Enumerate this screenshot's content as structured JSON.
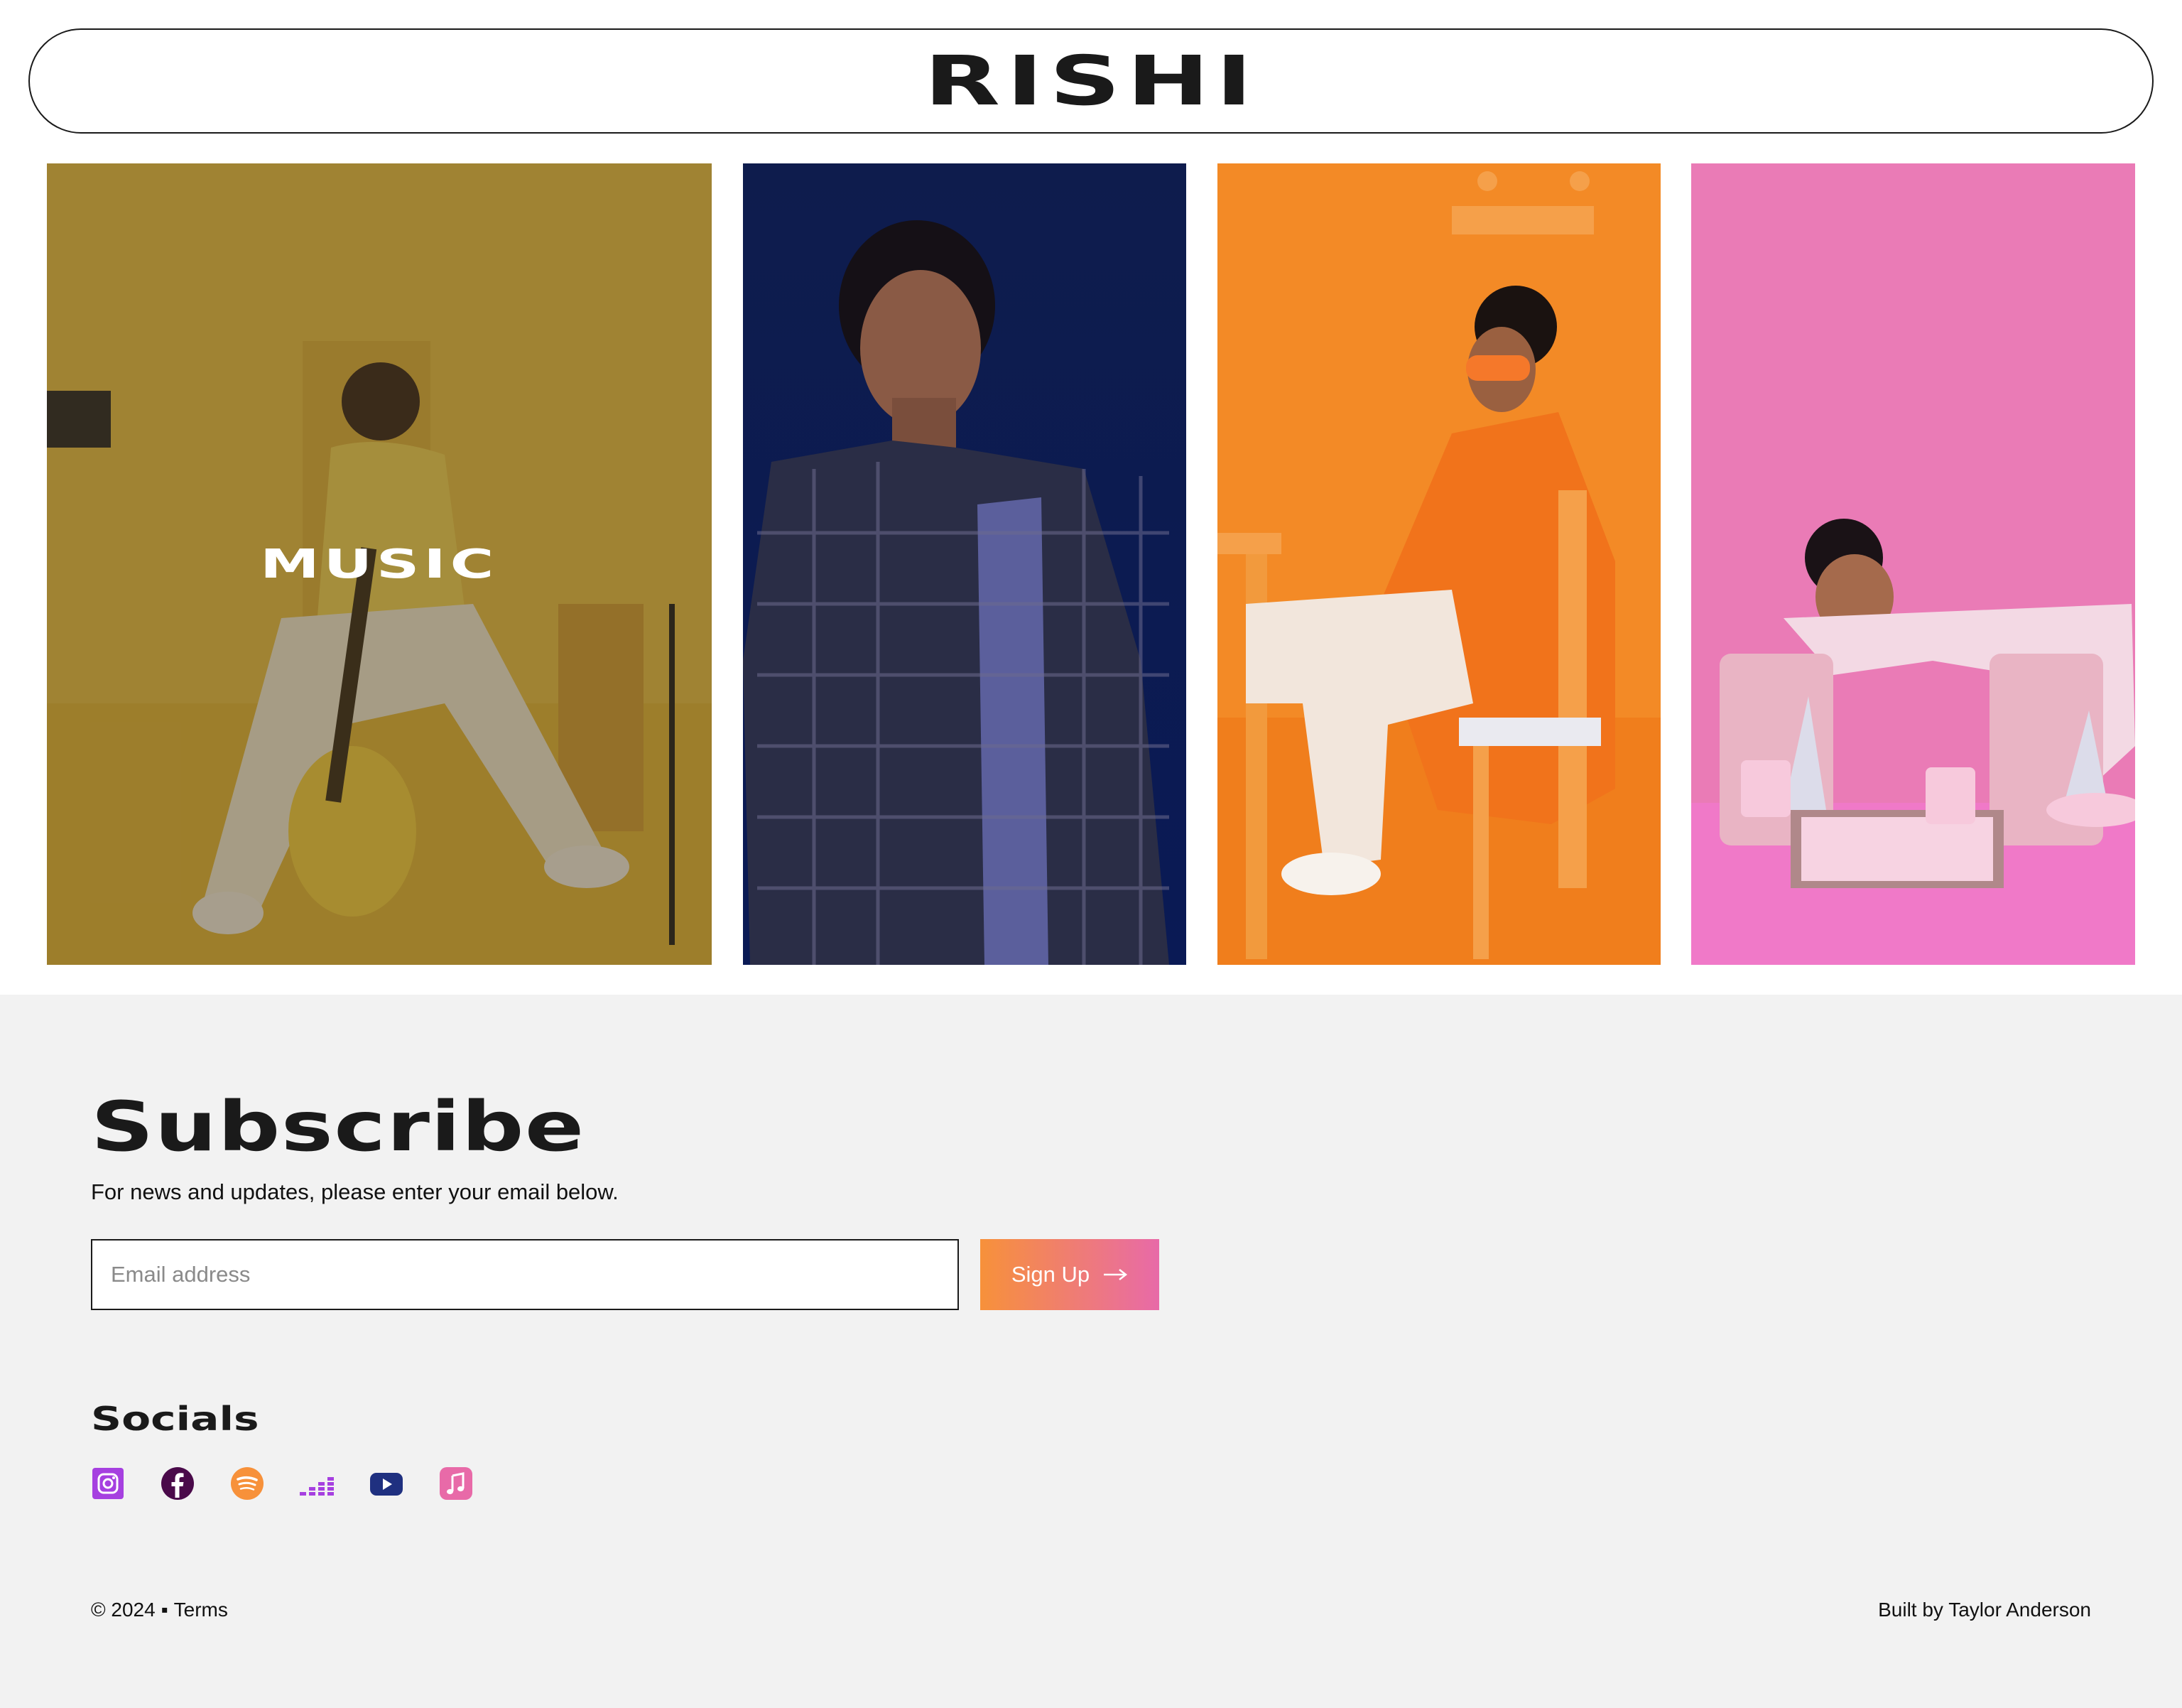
{
  "header": {
    "logo": "RISHI"
  },
  "gallery": {
    "tiles": [
      {
        "label": "MUSIC"
      },
      {
        "label": ""
      },
      {
        "label": ""
      },
      {
        "label": ""
      }
    ]
  },
  "subscribe": {
    "title": "Subscribe",
    "description": "For news and updates, please enter your email below.",
    "email_placeholder": "Email address",
    "button_label": "Sign Up"
  },
  "socials": {
    "title": "Socials",
    "icons": [
      "instagram-icon",
      "facebook-icon",
      "spotify-icon",
      "deezer-icon",
      "youtube-icon",
      "apple-music-icon"
    ]
  },
  "footer": {
    "copyright": "© 2024",
    "separator": "▪",
    "terms": "Terms",
    "built_by": "Built by Taylor Anderson"
  },
  "colors": {
    "accent_orange": "#f7913a",
    "accent_pink": "#e86aa8",
    "instagram": "#a640e0",
    "facebook": "#4a0a4a",
    "spotify": "#f7913a",
    "deezer": "#a640e0",
    "youtube": "#1f3080",
    "apple_music": "#e86aa8"
  }
}
